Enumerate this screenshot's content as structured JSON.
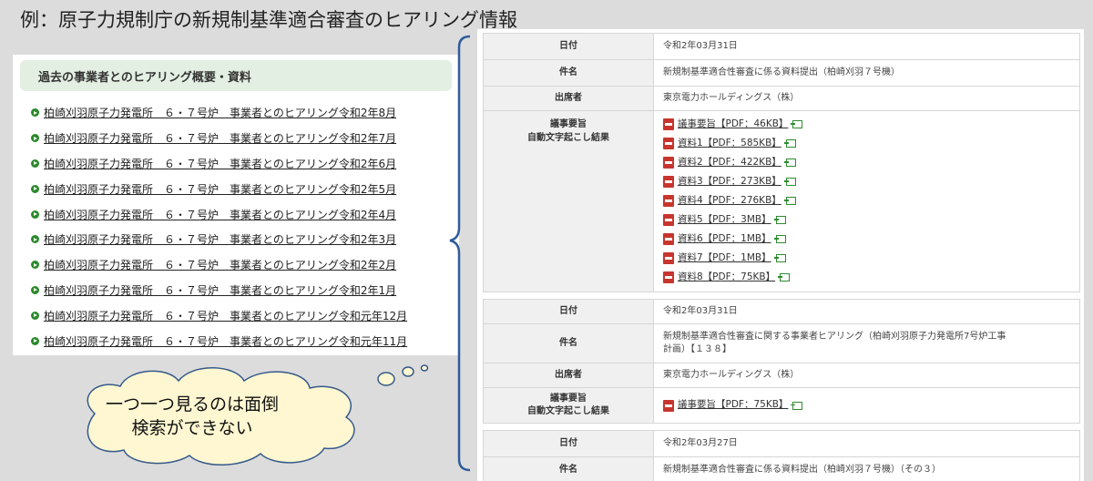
{
  "slide": {
    "title": "例：原子力規制庁の新規制基準適合審査のヒアリング情報"
  },
  "left_panel": {
    "header": "過去の事業者とのヒアリング概要・資料",
    "items": [
      "柏崎刈羽原子力発電所　６・７号炉　事業者とのヒアリング令和2年8月",
      "柏崎刈羽原子力発電所　６・７号炉　事業者とのヒアリング令和2年7月",
      "柏崎刈羽原子力発電所　６・７号炉　事業者とのヒアリング令和2年6月",
      "柏崎刈羽原子力発電所　６・７号炉　事業者とのヒアリング令和2年5月",
      "柏崎刈羽原子力発電所　６・７号炉　事業者とのヒアリング令和2年4月",
      "柏崎刈羽原子力発電所　６・７号炉　事業者とのヒアリング令和2年3月",
      "柏崎刈羽原子力発電所　６・７号炉　事業者とのヒアリング令和2年2月",
      "柏崎刈羽原子力発電所　６・７号炉　事業者とのヒアリング令和2年1月",
      "柏崎刈羽原子力発電所　６・７号炉　事業者とのヒアリング令和元年12月",
      "柏崎刈羽原子力発電所　６・７号炉　事業者とのヒアリング令和元年11月"
    ]
  },
  "records": [
    {
      "date_label": "日付",
      "date": "令和2年03月31日",
      "subject_label": "件名",
      "subject": "新規制基準適合性審査に係る資料提出（柏崎刈羽７号機）",
      "attendees_label": "出席者",
      "attendees": "東京電力ホールディングス（株）",
      "minutes_label_1": "議事要旨",
      "minutes_label_2": "自動文字起こし結果",
      "docs": [
        "議事要旨【PDF：46KB】",
        "資料1【PDF：585KB】",
        "資料2【PDF：422KB】",
        "資料3【PDF：273KB】",
        "資料4【PDF：276KB】",
        "資料5【PDF：3MB】",
        "資料6【PDF：1MB】",
        "資料7【PDF：1MB】",
        "資料8【PDF：75KB】"
      ]
    },
    {
      "date_label": "日付",
      "date": "令和2年03月31日",
      "subject_label": "件名",
      "subject_line1": "新規制基準適合性審査に関する事業者ヒアリング（柏崎刈羽原子力発電所7号炉工事",
      "subject_line2": "計画）【１３８】",
      "attendees_label": "出席者",
      "attendees": "東京電力ホールディングス（株）",
      "minutes_label_1": "議事要旨",
      "minutes_label_2": "自動文字起こし結果",
      "docs": [
        "議事要旨【PDF：75KB】"
      ]
    },
    {
      "date_label": "日付",
      "date": "令和2年03月27日",
      "subject_label": "件名",
      "subject": "新規制基準適合性審査に係る資料提出（柏崎刈羽７号機）（その３）"
    }
  ],
  "cloud": {
    "line1": "一つ一つ見るのは面倒",
    "line2": "検索ができない"
  },
  "colors": {
    "header_bg": "#e3efe3",
    "bullet": "#2a8a2a",
    "pdf_icon": "#c8352d",
    "bracket": "#2f5d9a"
  }
}
